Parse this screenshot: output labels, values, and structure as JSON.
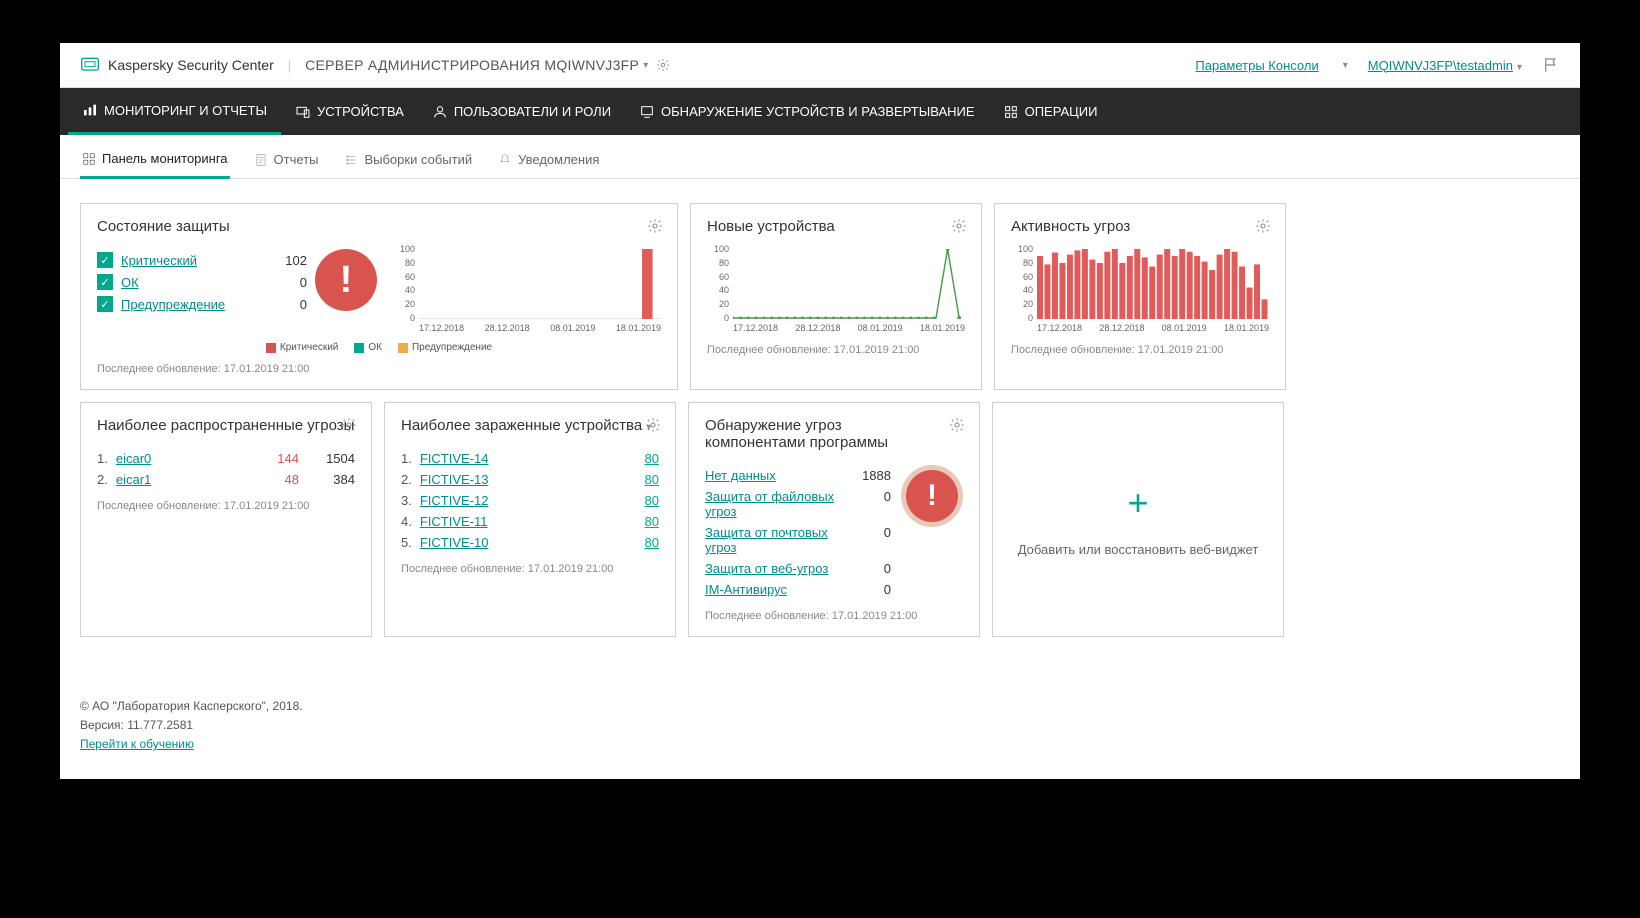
{
  "header": {
    "brand": "Kaspersky Security Center",
    "server": "СЕРВЕР АДМИНИСТРИРОВАНИЯ MQIWNVJ3FP",
    "console_params": "Параметры Консоли",
    "user": "MQIWNVJ3FP\\testadmin"
  },
  "nav": {
    "items": [
      "МОНИТОРИНГ И ОТЧЕТЫ",
      "УСТРОЙСТВА",
      "ПОЛЬЗОВАТЕЛИ И РОЛИ",
      "ОБНАРУЖЕНИЕ УСТРОЙСТВ И РАЗВЕРТЫВАНИЕ",
      "ОПЕРАЦИИ"
    ]
  },
  "subnav": {
    "items": [
      "Панель мониторинга",
      "Отчеты",
      "Выборки событий",
      "Уведомления"
    ]
  },
  "widget_protection": {
    "title": "Состояние защиты",
    "items": [
      {
        "label": "Критический",
        "value": "102"
      },
      {
        "label": "ОК",
        "value": "0"
      },
      {
        "label": "Предупреждение",
        "value": "0"
      }
    ],
    "legend": [
      "Критический",
      "ОК",
      "Предупреждение"
    ],
    "updated": "Последнее обновление: 17.01.2019 21:00"
  },
  "widget_new_devices": {
    "title": "Новые устройства",
    "updated": "Последнее обновление: 17.01.2019 21:00"
  },
  "widget_threat_activity": {
    "title": "Активность угроз",
    "updated": "Последнее обновление: 17.01.2019 21:00"
  },
  "common_chart": {
    "yticks": [
      "100",
      "80",
      "60",
      "40",
      "20",
      "0"
    ],
    "xticks": [
      "17.12.2018",
      "28.12.2018",
      "08.01.2019",
      "18.01.2019"
    ]
  },
  "widget_threats": {
    "title": "Наиболее распространенные угрозы",
    "rows": [
      {
        "idx": "1.",
        "name": "eicar0",
        "red": "144",
        "num": "1504"
      },
      {
        "idx": "2.",
        "name": "eicar1",
        "red": "48",
        "num": "384"
      }
    ],
    "updated": "Последнее обновление: 17.01.2019 21:00"
  },
  "widget_infected": {
    "title": "Наиболее зараженные устройства",
    "rows": [
      {
        "idx": "1.",
        "name": "FICTIVE-14",
        "num": "80"
      },
      {
        "idx": "2.",
        "name": "FICTIVE-13",
        "num": "80"
      },
      {
        "idx": "3.",
        "name": "FICTIVE-12",
        "num": "80"
      },
      {
        "idx": "4.",
        "name": "FICTIVE-11",
        "num": "80"
      },
      {
        "idx": "5.",
        "name": "FICTIVE-10",
        "num": "80"
      }
    ],
    "updated": "Последнее обновление: 17.01.2019 21:00"
  },
  "widget_components": {
    "title": "Обнаружение угроз компонентами программы",
    "rows": [
      {
        "name": "Нет данных",
        "val": "1888"
      },
      {
        "name": "Защита от файловых угроз",
        "val": "0"
      },
      {
        "name": "Защита от почтовых угроз",
        "val": "0"
      },
      {
        "name": "Защита от веб-угроз",
        "val": "0"
      },
      {
        "name": "IM-Антивирус",
        "val": "0"
      }
    ],
    "updated": "Последнее обновление: 17.01.2019 21:00"
  },
  "add_widget": "Добавить или восстановить веб-виджет",
  "footer": {
    "copyright": "© АО \"Лаборатория Касперского\", 2018.",
    "version": "Версия: 11.777.2581",
    "training": "Перейти к обучению"
  },
  "chart_data": [
    {
      "type": "bar",
      "title": "Состояние защиты",
      "categories_x": [
        "17.12.2018",
        "28.12.2018",
        "08.01.2019",
        "18.01.2019"
      ],
      "series": [
        {
          "name": "Критический",
          "values_sparse": [
            {
              "x": "17.01.2019",
              "y": 102
            }
          ]
        },
        {
          "name": "ОК",
          "values_sparse": []
        },
        {
          "name": "Предупреждение",
          "values_sparse": []
        }
      ],
      "ylim": [
        0,
        100
      ]
    },
    {
      "type": "line",
      "title": "Новые устройства",
      "x_range": [
        "17.12.2018",
        "18.01.2019"
      ],
      "points": [
        {
          "x": "16.01.2019",
          "y": 102
        },
        {
          "x": "17.01.2019",
          "y": 0
        }
      ],
      "baseline": 0,
      "ylim": [
        0,
        100
      ]
    },
    {
      "type": "bar",
      "title": "Активность угроз",
      "x_range": [
        "17.12.2018",
        "18.01.2019"
      ],
      "values": [
        90,
        78,
        95,
        80,
        92,
        98,
        100,
        85,
        80,
        96,
        100,
        80,
        90,
        100,
        88,
        75,
        92,
        100,
        90,
        100,
        96,
        90,
        82,
        70,
        92,
        100,
        96,
        75,
        45,
        78,
        28
      ],
      "ylim": [
        0,
        100
      ]
    }
  ]
}
